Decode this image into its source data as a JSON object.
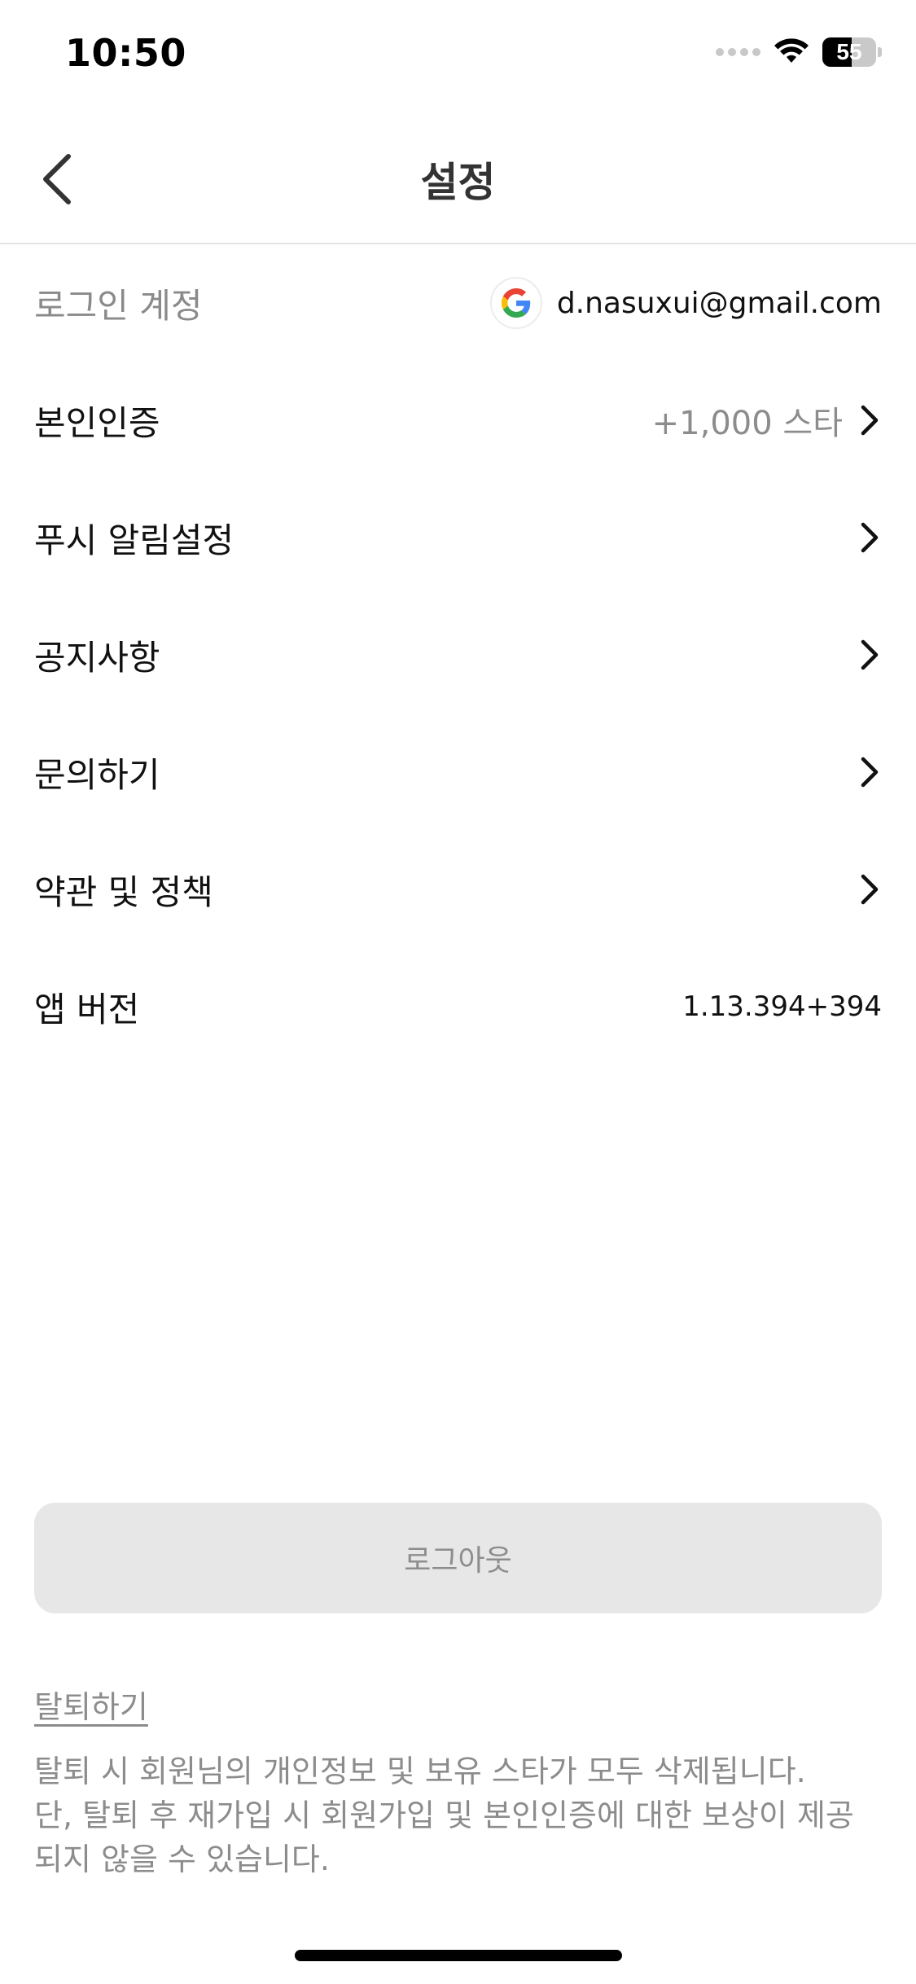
{
  "status_bar": {
    "time": "10:50",
    "battery": "55",
    "battery_level": 0.55
  },
  "header": {
    "title": "설정",
    "back_icon": "chevron-left-icon"
  },
  "settings": {
    "login_account": {
      "label": "로그인 계정",
      "provider_icon": "google-icon",
      "email": "d.nasuxui@gmail.com"
    },
    "identity_verification": {
      "label": "본인인증",
      "reward": "+1,000 스타"
    },
    "push_settings": {
      "label": "푸시 알림설정"
    },
    "notices": {
      "label": "공지사항"
    },
    "inquiry": {
      "label": "문의하기"
    },
    "terms": {
      "label": "약관 및 정책"
    },
    "app_version": {
      "label": "앱 버전",
      "value": "1.13.394+394"
    }
  },
  "logout": {
    "label": "로그아웃"
  },
  "withdraw": {
    "link_label": "탈퇴하기",
    "notice_line1": "탈퇴 시 회원님의 개인정보 및 보유 스타가 모두 삭제됩니다.",
    "notice_line2": "단, 탈퇴 후 재가입 시 회원가입 및 본인인증에 대한 보상이 제공되지 않을 수 있습니다."
  },
  "colors": {
    "muted_text": "#8c8c8c",
    "button_bg": "#e7e7e7",
    "divider": "#e4e4e4"
  }
}
